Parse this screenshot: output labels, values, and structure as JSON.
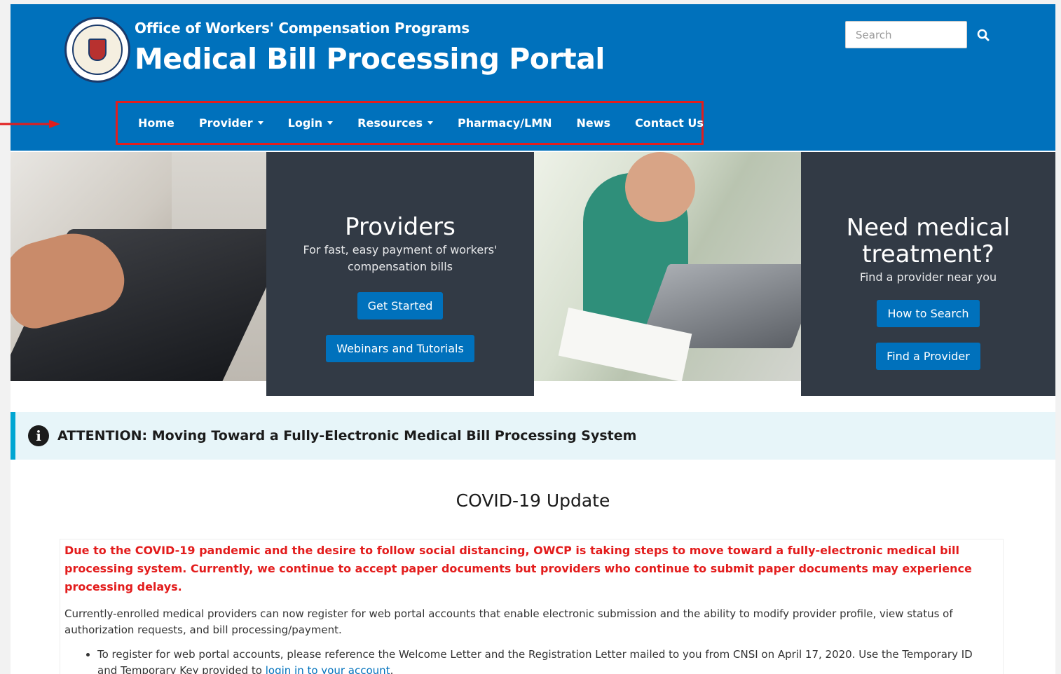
{
  "header": {
    "org_title": "Office of Workers' Compensation Programs",
    "portal_title": "Medical Bill Processing Portal",
    "seal_icon": "dol-seal-icon",
    "search": {
      "placeholder": "Search",
      "icon": "search-icon"
    }
  },
  "nav": {
    "items": [
      {
        "label": "Home",
        "dropdown": false
      },
      {
        "label": "Provider",
        "dropdown": true
      },
      {
        "label": "Login",
        "dropdown": true
      },
      {
        "label": "Resources",
        "dropdown": true
      },
      {
        "label": "Pharmacy/LMN",
        "dropdown": false
      },
      {
        "label": "News",
        "dropdown": false
      },
      {
        "label": "Contact Us",
        "dropdown": false
      }
    ],
    "highlight_color": "#e11d1d"
  },
  "hero": {
    "providers": {
      "title": "Providers",
      "subtitle_line1": "For fast, easy payment of workers'",
      "subtitle_line2": "compensation bills",
      "buttons": [
        "Get Started",
        "Webinars and Tutorials"
      ]
    },
    "treatment": {
      "title_line1": "Need medical",
      "title_line2": "treatment?",
      "subtitle": "Find a provider near you",
      "buttons": [
        "How to Search",
        "Find a Provider"
      ]
    }
  },
  "attention": {
    "icon": "info-icon",
    "text": "ATTENTION: Moving Toward a Fully-Electronic Medical Bill Processing System"
  },
  "covid": {
    "title": "COVID-19 Update",
    "alert_line1": "Due to the COVID-19 pandemic and the desire to follow social distancing, OWCP is taking steps to move toward a fully-electronic medical bill",
    "alert_line2": "processing system. Currently, we continue to accept paper documents but providers who continue to submit paper documents may experience",
    "alert_line3": "processing delays.",
    "para_line1": "Currently-enrolled medical providers can now register for web portal accounts that enable electronic submission and the ability to modify provider profile, view status of",
    "para_line2": "authorization requests, and bill processing/payment.",
    "bullet_line1": "To register for web portal accounts, please reference the Welcome Letter and the Registration Letter mailed to you from CNSI on April 17, 2020. Use the Temporary ID",
    "bullet_line2_prefix": "and Temporary Key provided to ",
    "bullet_link": "login in to your account",
    "bullet_line2_suffix": "."
  },
  "colors": {
    "brand_blue": "#0071bc",
    "panel_dark": "#323a45",
    "alert_red": "#e31c1c",
    "attention_bg": "#e7f5f9",
    "attention_border": "#00a6d2"
  }
}
